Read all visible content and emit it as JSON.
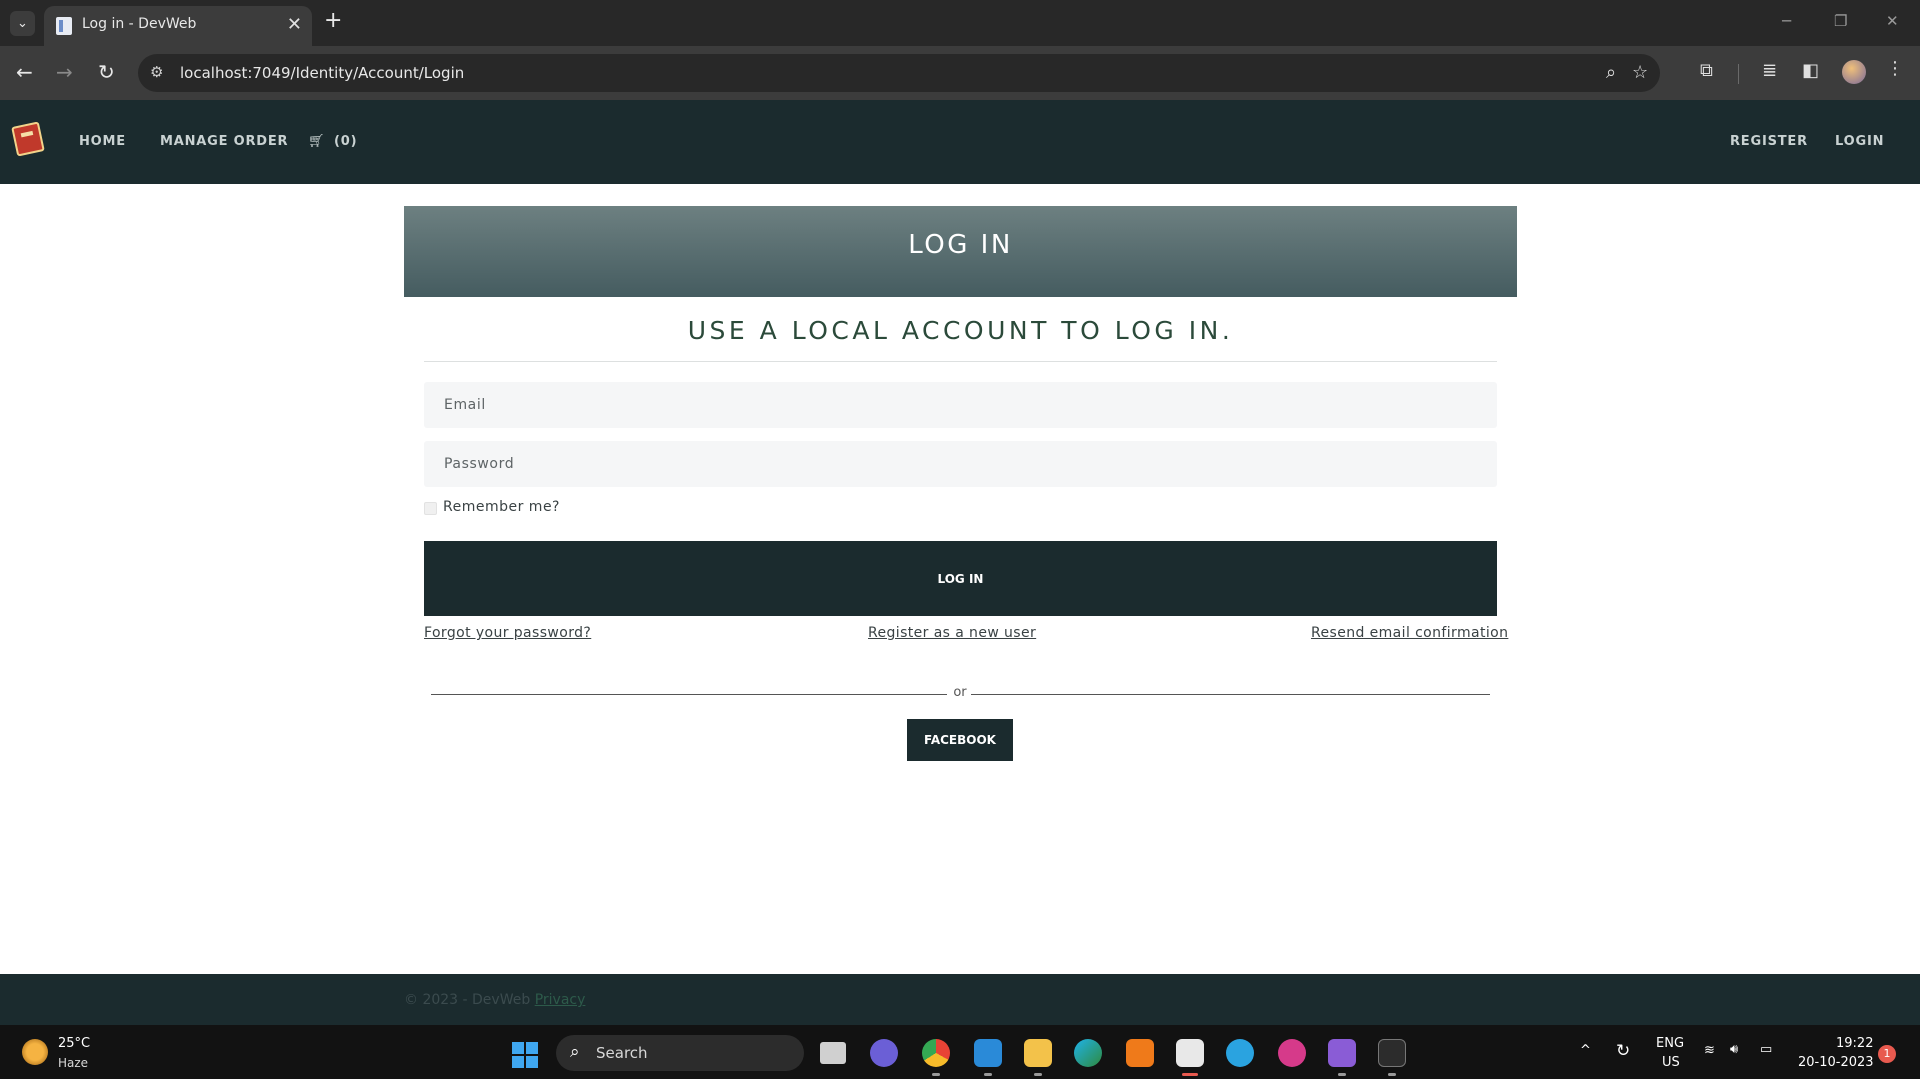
{
  "browser": {
    "tab_title": "Log in - DevWeb",
    "url": "localhost:7049/Identity/Account/Login",
    "new_tab_glyph": "+",
    "tab_close_glyph": "✕"
  },
  "nav": {
    "home": "HOME",
    "manage_order": "MANAGE ORDER",
    "cart_count": "(0)",
    "register": "REGISTER",
    "login": "LOGIN"
  },
  "main": {
    "banner_title": "LOG IN",
    "subtitle": "USE A LOCAL ACCOUNT TO LOG IN.",
    "email_placeholder": "Email",
    "password_placeholder": "Password",
    "remember_label": "Remember me?",
    "login_button": "LOG IN",
    "forgot_password": "Forgot your password?",
    "register_new": "Register as a new user",
    "resend_confirmation": "Resend email confirmation",
    "or_text": "or",
    "facebook_button": "FACEBOOK"
  },
  "footer": {
    "copyright": "© 2023 - DevWeb",
    "privacy": "Privacy"
  },
  "taskbar": {
    "temperature": "25°C",
    "weather": "Haze",
    "search": "Search",
    "lang_top": "ENG",
    "lang_bottom": "US",
    "time": "19:22",
    "date": "20-10-2023",
    "notification_count": "1"
  },
  "colors": {
    "nav_bg": "#1b2b2e",
    "banner_top": "#6d8081",
    "banner_bottom": "#455c60",
    "subtitle": "#2b4a3a",
    "button_bg": "#1b2b2e"
  }
}
